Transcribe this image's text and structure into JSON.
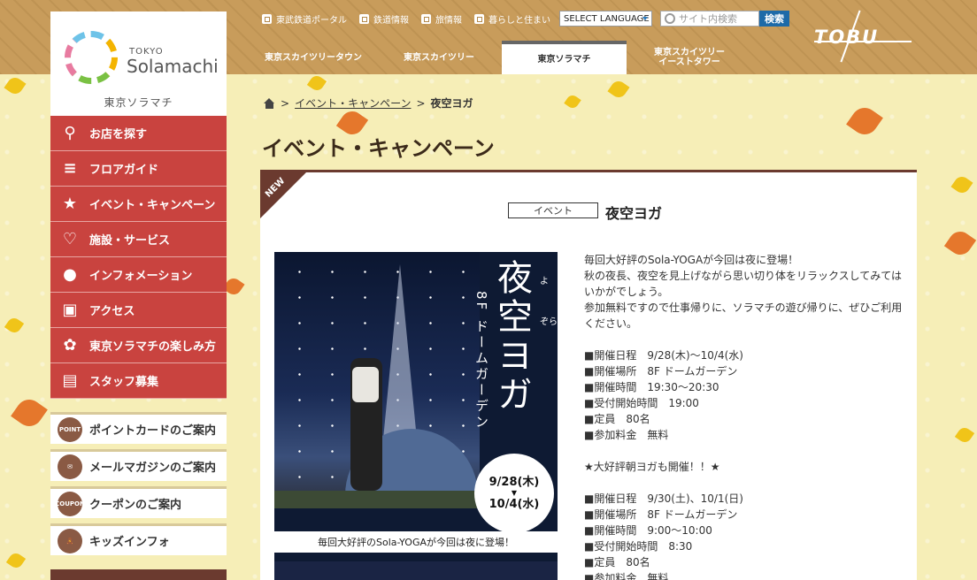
{
  "header": {
    "logo": {
      "tokyo": "TOKYO",
      "name": "Solamachi",
      "jp": "東京ソラマチ"
    },
    "top_links": [
      "東武鉄道ポータル",
      "鉄道情報",
      "旅情報",
      "暮らしと住まい"
    ],
    "language_select": "SELECT LANGUAGE",
    "search_placeholder": "サイト内検索",
    "search_button": "検索",
    "brand": "TOBU",
    "tabs": [
      {
        "label": "東京スカイツリータウン"
      },
      {
        "label": "東京スカイツリー"
      },
      {
        "label": "東京ソラマチ"
      },
      {
        "label": "東京スカイツリー\nイーストタワー"
      }
    ]
  },
  "sidebar": {
    "items": [
      {
        "label": "お店を探す",
        "icon": "search-icon"
      },
      {
        "label": "フロアガイド",
        "icon": "floors-icon"
      },
      {
        "label": "イベント・キャンペーン",
        "icon": "event-icon"
      },
      {
        "label": "施設・サービス",
        "icon": "heart-icon"
      },
      {
        "label": "インフォメーション",
        "icon": "speech-icon"
      },
      {
        "label": "アクセス",
        "icon": "train-icon"
      },
      {
        "label": "東京ソラマチの楽しみ方",
        "icon": "bulb-icon"
      },
      {
        "label": "スタッフ募集",
        "icon": "document-icon"
      }
    ],
    "sub_items": [
      {
        "label": "ポイントカードのご案内",
        "badge": "POINT"
      },
      {
        "label": "メールマガジンのご案内",
        "badge": "✉"
      },
      {
        "label": "クーポンのご案内",
        "badge": "COUPON"
      },
      {
        "label": "キッズインフォ",
        "badge": "🧸"
      }
    ]
  },
  "breadcrumb": {
    "parent": "イベント・キャンペーン",
    "current": "夜空ヨガ"
  },
  "page_title": "イベント・キャンペーン",
  "event": {
    "new_tag": "NEW",
    "category": "イベント",
    "title": "夜空ヨガ",
    "poster": {
      "title": "夜空ヨガ",
      "ruby_yo": "よ",
      "ruby_zora": "ぞら",
      "subtitle": "8F ドームガーデン",
      "date_from": "9/28(木)",
      "date_to": "10/4(水)",
      "caption": "毎回大好評のSola-YOGAが今回は夜に登場！"
    },
    "description": [
      "毎回大好評のSola-YOGAが今回は夜に登場！",
      "秋の夜長、夜空を見上げながら思い切り体をリラックスしてみてはいかがでしょう。",
      "参加無料ですので仕事帰りに、ソラマチの遊び帰りに、ぜひご利用ください。",
      "",
      "■開催日程　9/28(木)～10/4(水)",
      "■開催場所　8F ドームガーデン",
      "■開催時間　19:30～20:30",
      "■受付開始時間　19:00",
      "■定員　80名",
      "■参加料金　無料",
      "",
      "★大好評朝ヨガも開催！！★",
      "",
      "■開催日程　9/30(土)、10/1(日)",
      "■開催場所　8F ドームガーデン",
      "■開催時間　9:00～10:00",
      "■受付開始時間　8:30",
      "■定員　80名",
      "■参加料金　無料"
    ]
  },
  "colors": {
    "nav_red": "#c9433f",
    "brown": "#6b3a2f",
    "header_tan": "#c89c5b",
    "bg_cream": "#f6eeb7"
  }
}
